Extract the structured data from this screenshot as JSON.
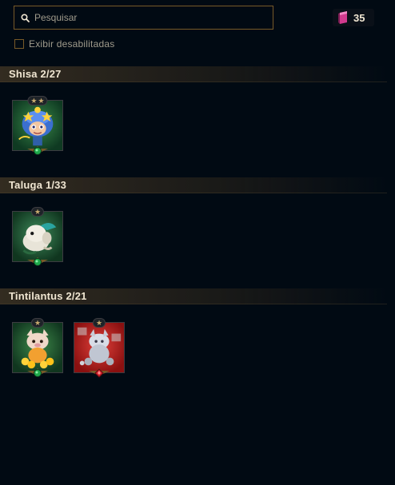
{
  "search": {
    "placeholder": "Pesquisar",
    "value": ""
  },
  "currency": {
    "value": "35",
    "icon": "gem-icon",
    "color": "#d13a8e"
  },
  "filter": {
    "label": "Exibir desabilitadas",
    "checked": false
  },
  "groups": [
    {
      "title": "Shisa 2/27",
      "items": [
        {
          "stars": 2,
          "rarity": "green",
          "art": "shisa-star-icon"
        }
      ]
    },
    {
      "title": "Taluga 1/33",
      "items": [
        {
          "stars": 1,
          "rarity": "green",
          "art": "taluga-icon"
        }
      ]
    },
    {
      "title": "Tintilantus 2/21",
      "items": [
        {
          "stars": 1,
          "rarity": "green",
          "art": "tintilantus-gold-icon"
        },
        {
          "stars": 1,
          "rarity": "red",
          "art": "tintilantus-silver-icon"
        }
      ]
    }
  ],
  "colors": {
    "background": "#010a13",
    "gold": "#c8aa6e",
    "border": "#785a28",
    "green": "#1ea84a",
    "red": "#d0202a"
  }
}
